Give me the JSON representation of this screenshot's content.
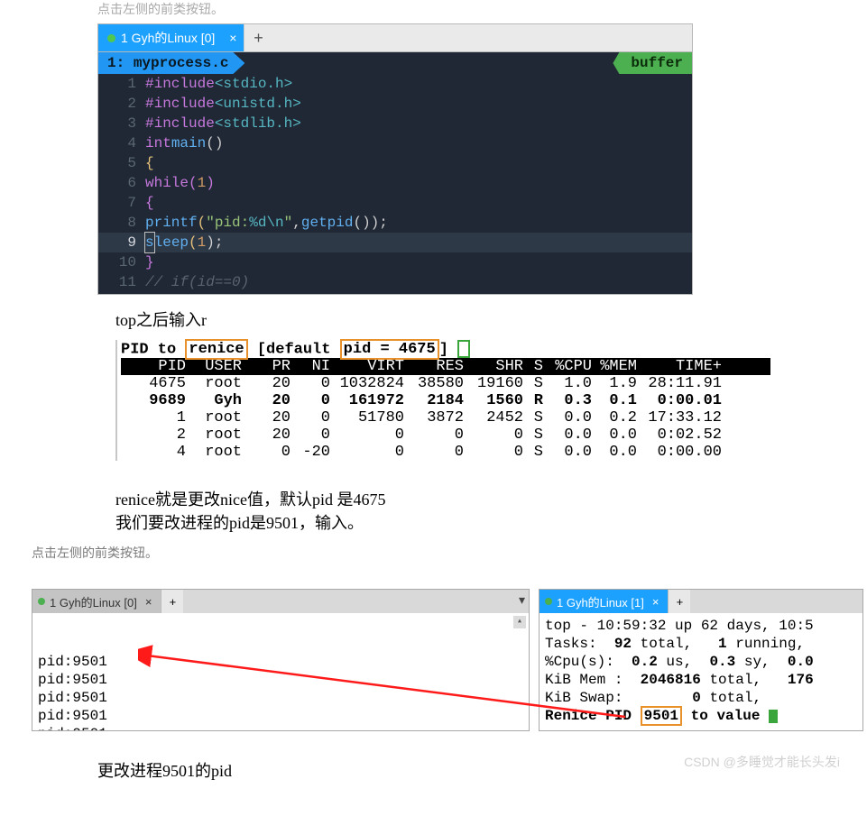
{
  "editor": {
    "tab_label": "1 Gyh的Linux [0]",
    "tab_close": "×",
    "tab_new": "+",
    "filename_num": "1:",
    "filename": "myprocess.c",
    "buffer_label": "buffer",
    "lines": {
      "l1a": "#include",
      "l1b": "<stdio.h>",
      "l2a": "#include",
      "l2b": "<unistd.h>",
      "l3a": "#include",
      "l3b": "<stdlib.h>",
      "l4a": "int",
      "l4b": "main",
      "l4c": "()",
      "l5": "{",
      "l6a": "while",
      "l6b": "(",
      "l6c": "1",
      "l6d": ")",
      "l7": "{",
      "l8a": "printf",
      "l8b": "(",
      "l8c": "\"pid:",
      "l8d": "%d",
      "l8e": "\\n",
      "l8f": "\"",
      "l8g": ",",
      "l8h": "getpid",
      "l8i": "());",
      "l9a": "s",
      "l9b": "leep",
      "l9c": "(",
      "l9d": "1",
      "l9e": ");",
      "l10": "}",
      "l11": "// if(id==0)"
    },
    "gutter": [
      "1",
      "2",
      "3",
      "4",
      "5",
      "6",
      "7",
      "8",
      "9",
      "10",
      "11"
    ]
  },
  "caption_top_after": "top之后输入r",
  "top": {
    "prompt_a": "PID to ",
    "prompt_renice": "renice",
    "prompt_b": " [default ",
    "prompt_pid": "pid = 4675",
    "prompt_c": "] ",
    "headers": {
      "pid": "PID",
      "user": "USER",
      "pr": "PR",
      "ni": "NI",
      "virt": "VIRT",
      "res": "RES",
      "shr": "SHR",
      "s": "S",
      "cpu": "%CPU",
      "mem": "%MEM",
      "time": "TIME+"
    },
    "rows": [
      {
        "pid": "4675",
        "user": "root",
        "pr": "20",
        "ni": "0",
        "virt": "1032824",
        "res": "38580",
        "shr": "19160",
        "s": "S",
        "cpu": "1.0",
        "mem": "1.9",
        "time": "28:11.91"
      },
      {
        "pid": "9689",
        "user": "Gyh",
        "pr": "20",
        "ni": "0",
        "virt": "161972",
        "res": "2184",
        "shr": "1560",
        "s": "R",
        "cpu": "0.3",
        "mem": "0.1",
        "time": "0:00.01"
      },
      {
        "pid": "1",
        "user": "root",
        "pr": "20",
        "ni": "0",
        "virt": "51780",
        "res": "3872",
        "shr": "2452",
        "s": "S",
        "cpu": "0.0",
        "mem": "0.2",
        "time": "17:33.12"
      },
      {
        "pid": "2",
        "user": "root",
        "pr": "20",
        "ni": "0",
        "virt": "0",
        "res": "0",
        "shr": "0",
        "s": "S",
        "cpu": "0.0",
        "mem": "0.0",
        "time": "0:02.52"
      },
      {
        "pid": "4",
        "user": "root",
        "pr": "0",
        "ni": "-20",
        "virt": "0",
        "res": "0",
        "shr": "0",
        "s": "S",
        "cpu": "0.0",
        "mem": "0.0",
        "time": "0:00.00"
      }
    ]
  },
  "caption_renice_1": "renice就是更改nice值，默认pid 是4675",
  "caption_renice_2": "我们要改进程的pid是9501，输入。",
  "bottom": {
    "left_tab": "1 Gyh的Linux [0]",
    "right_tab": "1 Gyh的Linux [1]",
    "tab_close": "×",
    "tab_new": "+",
    "pid_line": "pid:9501",
    "right_l1": "top - 10:59:32 up 62 days, 10:5",
    "right_l2a": "Tasks:  ",
    "right_l2b": "92 ",
    "right_l2c": "total,   ",
    "right_l2d": "1 ",
    "right_l2e": "running,",
    "right_l3a": "%Cpu(s):  ",
    "right_l3b": "0.2 ",
    "right_l3c": "us,  ",
    "right_l3d": "0.3 ",
    "right_l3e": "sy,  ",
    "right_l3f": "0.0",
    "right_l4a": "KiB Mem :  ",
    "right_l4b": "2046816 ",
    "right_l4c": "total,   ",
    "right_l4d": "176",
    "right_l5a": "KiB Swap:        ",
    "right_l5b": "0 ",
    "right_l5c": "total,",
    "right_l6a": "Renice PID ",
    "right_l6b": "9501",
    "right_l6c": " to value "
  },
  "truncated_top": "点击左侧的前类按钮。",
  "caption_bottom": "更改进程9501的pid",
  "watermark": "CSDN @多睡觉才能长头发i"
}
